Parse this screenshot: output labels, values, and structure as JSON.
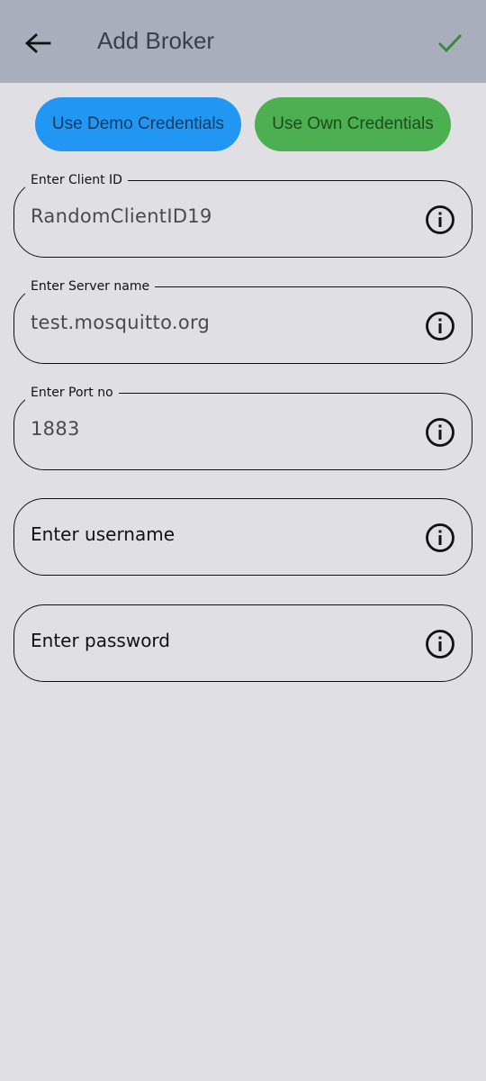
{
  "appbar": {
    "title": "Add Broker",
    "back_icon": "arrow-left-icon",
    "confirm_icon": "check-icon",
    "background": "#a8aebb",
    "confirm_color": "#3a8a3a"
  },
  "credentials": {
    "demo_label": "Use Demo Credentials",
    "own_label": "Use Own Credentials",
    "demo_color": "#2196f3",
    "own_color": "#4caf50"
  },
  "fields": {
    "client_id": {
      "label": "Enter Client ID",
      "value": "RandomClientID19"
    },
    "server": {
      "label": "Enter Server name",
      "value": "test.mosquitto.org"
    },
    "port": {
      "label": "Enter Port no",
      "value": "1883"
    },
    "username": {
      "placeholder": "Enter username"
    },
    "password": {
      "placeholder": "Enter password"
    }
  },
  "info_icon": "info-circle-icon"
}
